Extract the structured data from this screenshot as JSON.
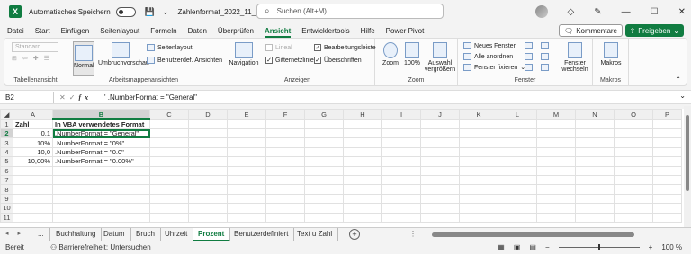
{
  "titlebar": {
    "autosave_label": "Automatisches Speichern",
    "autosave_state": "Aus",
    "doc_title": "Zahlenformat_2022_11_11.xlsm",
    "search_placeholder": "Suchen (Alt+M)"
  },
  "menu": [
    "Datei",
    "Start",
    "Einfügen",
    "Seitenlayout",
    "Formeln",
    "Daten",
    "Überprüfen",
    "Ansicht",
    "Entwicklertools",
    "Hilfe",
    "Power Pivot"
  ],
  "menu_active": "Ansicht",
  "buttons": {
    "kommentare": "Kommentare",
    "freigeben": "Freigeben"
  },
  "ribbon": {
    "tabellenansicht": {
      "label": "Tabellenansicht",
      "dropdown": "Standard"
    },
    "arbeitsmappen": {
      "label": "Arbeitsmappenansichten",
      "normal": "Normal",
      "umbruch": "Umbruchvorschau",
      "seitenlayout": "Seitenlayout",
      "benutzerdef": "Benutzerdef. Ansichten"
    },
    "anzeigen": {
      "label": "Anzeigen",
      "navigation": "Navigation",
      "lineal": "Lineal",
      "gitternetz": "Gitternetzlinien",
      "bearbeitungsleiste": "Bearbeitungsleiste",
      "ueberschriften": "Überschriften"
    },
    "zoom": {
      "label": "Zoom",
      "zoom": "Zoom",
      "hundert": "100%",
      "auswahl": "Auswahl vergrößern"
    },
    "fenster": {
      "label": "Fenster",
      "neues": "Neues Fenster",
      "alle": "Alle anordnen",
      "fixieren": "Fenster fixieren",
      "wechseln": "Fenster wechseln"
    },
    "makros": {
      "label": "Makros",
      "makros": "Makros"
    }
  },
  "formula": {
    "cell_ref": "B2",
    "fx": "fx",
    "value": "' .NumberFormat = \"General\""
  },
  "grid": {
    "columns": [
      "A",
      "B",
      "C",
      "D",
      "E",
      "F",
      "G",
      "H",
      "I",
      "J",
      "K",
      "L",
      "M",
      "N",
      "O",
      "P"
    ],
    "rows": [
      [
        "Zahl",
        "In VBA verwendetes Format"
      ],
      [
        "0,1",
        "  .NumberFormat = \"General\""
      ],
      [
        "10%",
        "  .NumberFormat = \"0%\""
      ],
      [
        "10,0",
        "  .NumberFormat = \"0.0\""
      ],
      [
        "10,00%",
        "  .NumberFormat = \"0.00%\""
      ],
      [
        "",
        ""
      ],
      [
        "",
        ""
      ],
      [
        "",
        ""
      ],
      [
        "",
        ""
      ],
      [
        "",
        ""
      ],
      [
        "",
        ""
      ]
    ]
  },
  "sheets": [
    "...",
    "Buchhaltung",
    "Datum",
    "Bruch",
    "Uhrzeit",
    "Prozent",
    "Benutzerdefiniert",
    "Text u Zahl"
  ],
  "active_sheet": "Prozent",
  "status": {
    "ready": "Bereit",
    "accessibility": "Barrierefreiheit: Untersuchen",
    "zoom": "100 %"
  },
  "colors": {
    "accent": "#107c41"
  }
}
